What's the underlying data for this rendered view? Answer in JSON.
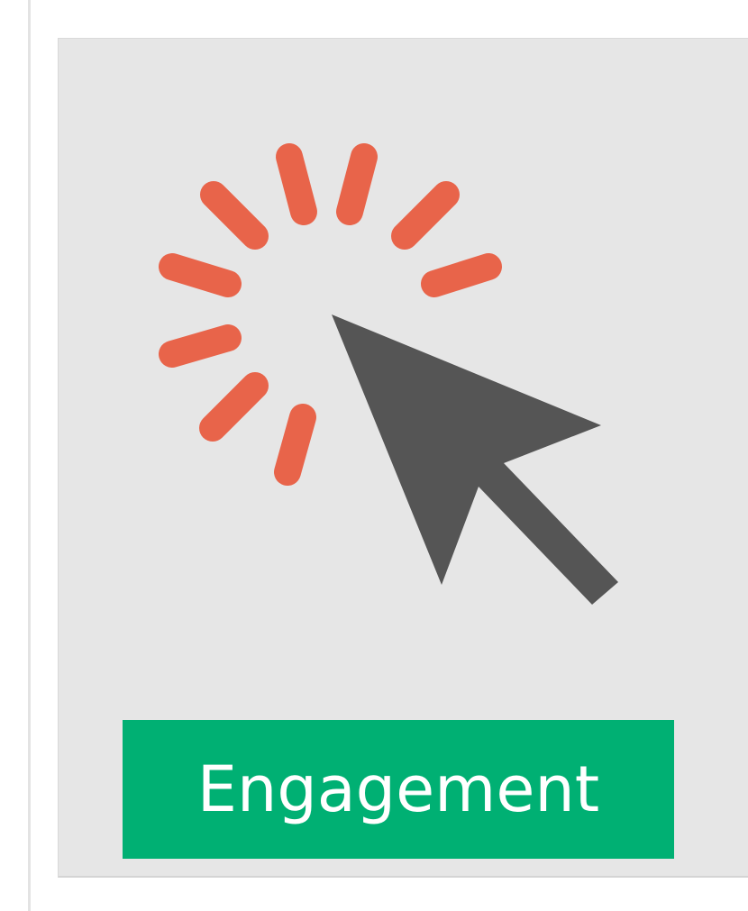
{
  "card": {
    "label": "Engagement"
  },
  "icon": {
    "name": "click-cursor-icon",
    "ray_color": "#e8644a",
    "cursor_color": "#555555"
  },
  "colors": {
    "card_background": "#e6e6e6",
    "badge_background": "#00b073",
    "badge_text": "#ffffff"
  }
}
